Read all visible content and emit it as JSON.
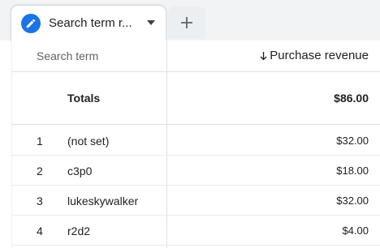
{
  "tabs": {
    "active_label": "Search term r...",
    "active_icon": "pencil-icon",
    "caret_icon": "caret-down-icon",
    "add_icon": "plus-icon"
  },
  "table": {
    "dimension_header": "Search term",
    "metric_header": "Purchase revenue",
    "sort_icon": "arrow-down-icon",
    "totals_label": "Totals",
    "totals_value": "$86.00",
    "rows": [
      {
        "index": "1",
        "term": "(not set)",
        "value": "$32.00"
      },
      {
        "index": "2",
        "term": "c3p0",
        "value": "$18.00"
      },
      {
        "index": "3",
        "term": "lukeskywalker",
        "value": "$32.00"
      },
      {
        "index": "4",
        "term": "r2d2",
        "value": "$4.00"
      }
    ]
  },
  "colors": {
    "accent": "#1a73e8",
    "tab_strip": "#f1f3f4",
    "text": "#202124",
    "muted_text": "#5f6368",
    "divider": "#e0e0e0"
  }
}
